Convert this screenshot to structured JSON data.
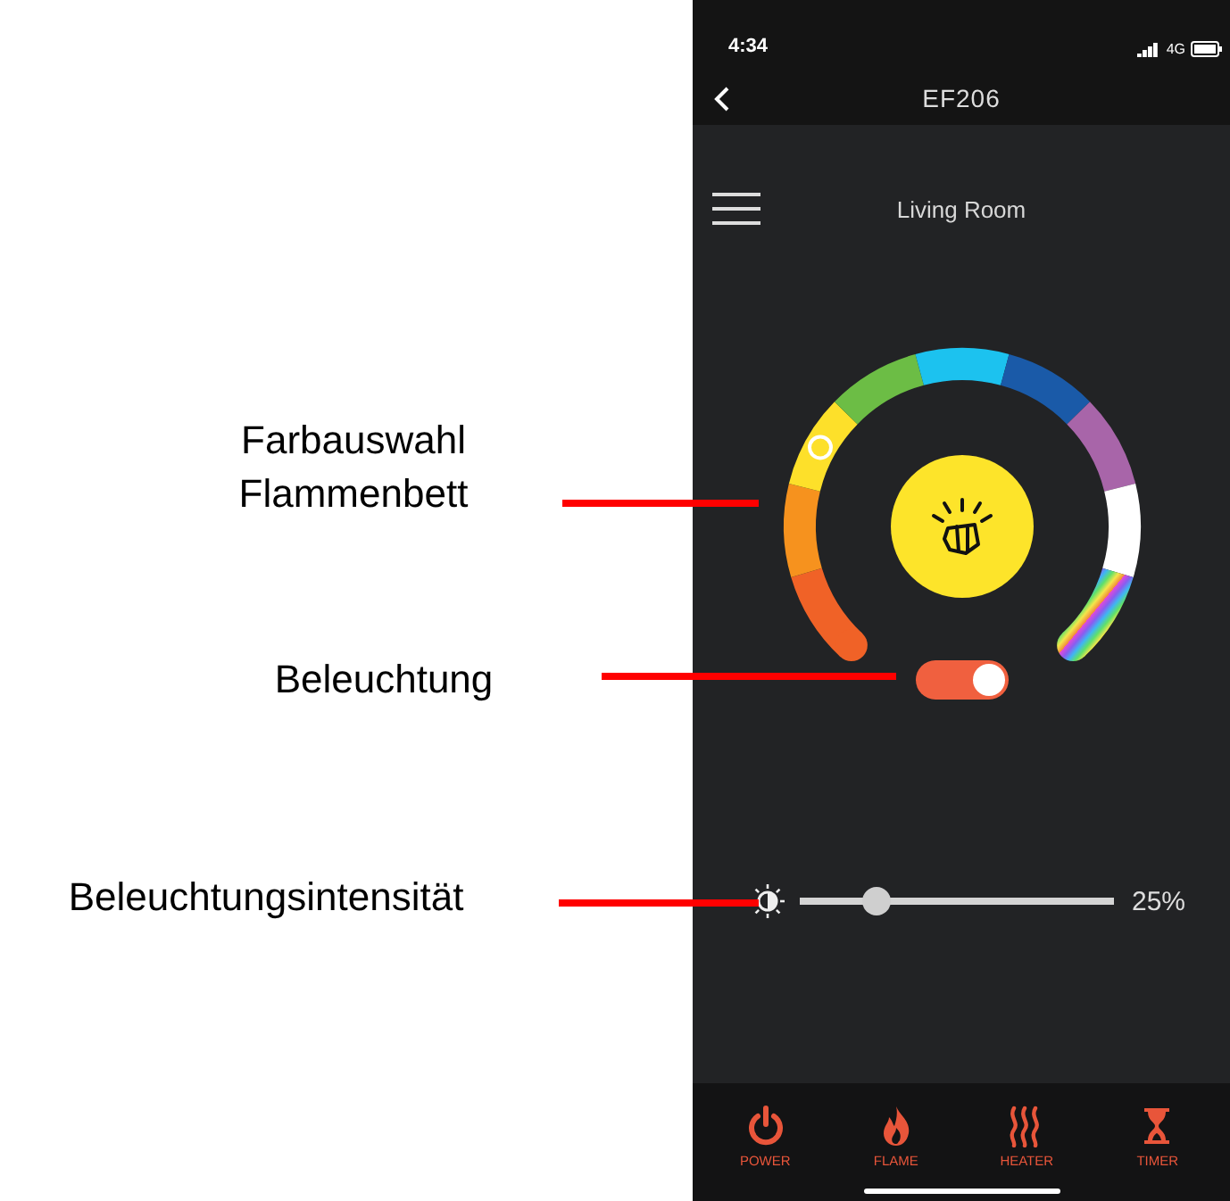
{
  "annotations": [
    {
      "text": "Farbauswahl Flammenbett"
    },
    {
      "text": "Beleuchtung"
    },
    {
      "text": "Beleuchtungsintensität"
    }
  ],
  "status_bar": {
    "time": "4:34",
    "network": "4G"
  },
  "nav": {
    "title": "EF206"
  },
  "room": {
    "title": "Living Room"
  },
  "color_ring": {
    "segments": [
      {
        "kind": "solid",
        "color": "#f06227",
        "selected": false
      },
      {
        "kind": "solid",
        "color": "#f6921e",
        "selected": false
      },
      {
        "kind": "solid",
        "color": "#fde02a",
        "selected": true
      },
      {
        "kind": "solid",
        "color": "#6cbd45",
        "selected": false
      },
      {
        "kind": "solid",
        "color": "#1cc2ef",
        "selected": false
      },
      {
        "kind": "solid",
        "color": "#1a5aa8",
        "selected": false
      },
      {
        "kind": "solid",
        "color": "#a865a9",
        "selected": false
      },
      {
        "kind": "solid",
        "color": "#ffffff",
        "selected": false
      },
      {
        "kind": "rainbow",
        "selected": false
      }
    ]
  },
  "light_toggle": {
    "on": true
  },
  "brightness": {
    "level": 0.23,
    "reading": "25%"
  },
  "tabs": [
    {
      "kind": "power",
      "label": "POWER"
    },
    {
      "kind": "flame",
      "label": "FLAME"
    },
    {
      "kind": "heater",
      "label": "HEATER"
    },
    {
      "kind": "timer",
      "label": "TIMER"
    }
  ]
}
